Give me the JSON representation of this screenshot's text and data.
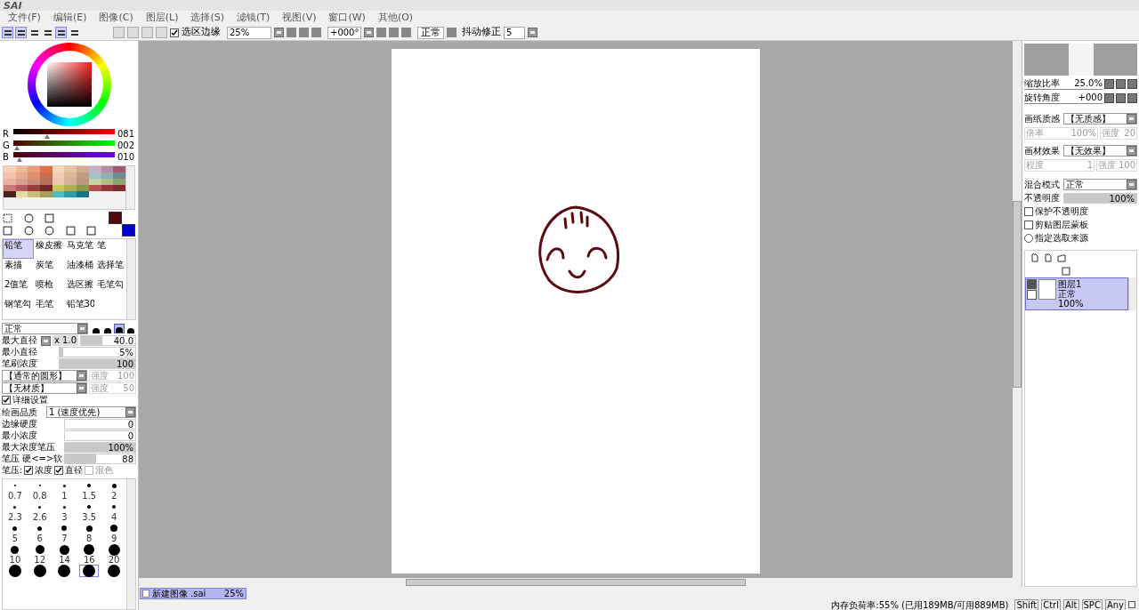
{
  "app": {
    "logo": "SAI"
  },
  "menu": [
    "文件(F)",
    "编辑(E)",
    "图像(C)",
    "图层(L)",
    "选择(S)",
    "滤镜(T)",
    "视图(V)",
    "窗口(W)",
    "其他(O)"
  ],
  "panel_toggles": [
    {
      "selected": true
    },
    {
      "selected": true
    },
    {
      "selected": false
    },
    {
      "selected": false
    },
    {
      "selected": true
    },
    {
      "selected": false
    }
  ],
  "toolbar": {
    "selection_edge": {
      "label": "选区边缘",
      "checked": true
    },
    "zoom": "25%",
    "rotation": "+000°",
    "view_mode": "正常",
    "stabilizer": {
      "label": "抖动修正",
      "value": "5"
    }
  },
  "color_sliders": [
    {
      "kind": "r",
      "label": "R",
      "level": 0.32,
      "reading": "081"
    },
    {
      "kind": "g",
      "label": "G",
      "level": 0.01,
      "reading": "002"
    },
    {
      "kind": "b",
      "label": "B",
      "level": 0.04,
      "reading": "010"
    }
  ],
  "swatches": [
    {
      "color": "#f5d2b9"
    },
    {
      "color": "#f0b996"
    },
    {
      "color": "#eb9b73"
    },
    {
      "color": "#e06e46"
    },
    {
      "color": "#f5d7be"
    },
    {
      "color": "#e6c3a5"
    },
    {
      "color": "#d2aa91"
    },
    {
      "color": "#c3afc8"
    },
    {
      "color": "#b48ca0"
    },
    {
      "color": "#a05a6e"
    },
    {
      "color": "#f0c3aa"
    },
    {
      "color": "#e6aa8c"
    },
    {
      "color": "#dc916e"
    },
    {
      "color": "#c86e50"
    },
    {
      "color": "#f0cdb4"
    },
    {
      "color": "#dcb496"
    },
    {
      "color": "#c39b82"
    },
    {
      "color": "#a5bec8"
    },
    {
      "color": "#8cafb4"
    },
    {
      "color": "#6e8c96"
    },
    {
      "color": "#e6b4a0"
    },
    {
      "color": "#d7a08c"
    },
    {
      "color": "#c88c78"
    },
    {
      "color": "#b46e5a"
    },
    {
      "color": "#ebc8af"
    },
    {
      "color": "#d7af96"
    },
    {
      "color": "#be967d"
    },
    {
      "color": "#c8d2a0"
    },
    {
      "color": "#afbe82"
    },
    {
      "color": "#8ca56e"
    },
    {
      "color": "#c87878"
    },
    {
      "color": "#b45a5a"
    },
    {
      "color": "#963c3c"
    },
    {
      "color": "#6e2828"
    },
    {
      "color": "#c8c85a"
    },
    {
      "color": "#b4aa50"
    },
    {
      "color": "#8c9646"
    },
    {
      "color": "#b45050"
    },
    {
      "color": "#963737"
    },
    {
      "color": "#7d2d2d"
    },
    {
      "color": "#502020"
    },
    {
      "color": "#e6dca0"
    },
    {
      "color": "#c8be78"
    },
    {
      "color": "#a0a05a"
    },
    {
      "color": "#46bec3"
    },
    {
      "color": "#28a0aa"
    },
    {
      "color": "#147882"
    }
  ],
  "current_colors": [
    {
      "color": "#520a0e"
    },
    {
      "color": "#0000cc"
    }
  ],
  "tools": [
    {
      "label": "铅笔",
      "selected": true
    },
    {
      "label": "橡皮擦",
      "selected": false
    },
    {
      "label": "马克笔",
      "selected": false
    },
    {
      "label": "笔",
      "selected": false
    },
    {
      "label": "素描",
      "selected": false
    },
    {
      "label": "炭笔",
      "selected": false
    },
    {
      "label": "油漆桶",
      "selected": false
    },
    {
      "label": "选择笔",
      "selected": false
    },
    {
      "label": "2值笔",
      "selected": false
    },
    {
      "label": "喷枪",
      "selected": false
    },
    {
      "label": "选区擦",
      "selected": false
    },
    {
      "label": "毛笔勾",
      "selected": false
    },
    {
      "label": "钢笔勾",
      "selected": false
    },
    {
      "label": "毛笔",
      "selected": false
    },
    {
      "label": "铅笔30",
      "selected": false
    }
  ],
  "brush": {
    "blend_mode": "正常",
    "shapes": [
      {
        "selected": false
      },
      {
        "selected": false
      },
      {
        "selected": true
      },
      {
        "selected": false
      }
    ],
    "max_diameter": {
      "label": "最大直径",
      "multiplier": "x 1.0",
      "value": "40.0",
      "level": 0.4
    },
    "min_diameter": {
      "label": "最小直径",
      "value": "5%",
      "level": 0.05
    },
    "density": {
      "label": "笔刷浓度",
      "value": "100",
      "level": 1
    },
    "shape": {
      "value": "【通常的圆形】",
      "strength_label": "强度",
      "strength": "100",
      "disabled": true
    },
    "texture": {
      "value": "【无材质】",
      "strength_label": "强度",
      "strength": "50",
      "disabled": true
    },
    "details": {
      "label": "详细设置",
      "checked": true
    },
    "quality": {
      "label": "绘画品质",
      "value": "1 (速度优先)"
    },
    "params": [
      {
        "label": "边缘硬度",
        "value": "0",
        "level": 0
      },
      {
        "label": "最小浓度",
        "value": "0",
        "level": 0
      },
      {
        "label": "最大浓度笔压",
        "value": "100%",
        "level": 1
      },
      {
        "label": "笔压 硬<=>软",
        "value": "88",
        "level": 0.44
      }
    ],
    "pressure": {
      "label": "笔压:",
      "options": [
        {
          "label": "浓度",
          "checked": true,
          "disabled": false
        },
        {
          "label": "直径",
          "checked": true,
          "disabled": false
        },
        {
          "label": "混色",
          "checked": false,
          "disabled": true
        }
      ]
    }
  },
  "brush_sizes": [
    {
      "label": "0.7",
      "selected": false
    },
    {
      "label": "0.8",
      "selected": false
    },
    {
      "label": "1",
      "selected": false
    },
    {
      "label": "1.5",
      "selected": false
    },
    {
      "label": "2",
      "selected": false
    },
    {
      "label": "2.3",
      "selected": false
    },
    {
      "label": "2.6",
      "selected": false
    },
    {
      "label": "3",
      "selected": false
    },
    {
      "label": "3.5",
      "selected": false
    },
    {
      "label": "4",
      "selected": false
    },
    {
      "label": "5",
      "selected": false
    },
    {
      "label": "6",
      "selected": false
    },
    {
      "label": "7",
      "selected": false
    },
    {
      "label": "8",
      "selected": false
    },
    {
      "label": "9",
      "selected": false
    },
    {
      "label": "10",
      "selected": false
    },
    {
      "label": "12",
      "selected": false
    },
    {
      "label": "14",
      "selected": false
    },
    {
      "label": "16",
      "selected": false
    },
    {
      "label": "20",
      "selected": false
    },
    {
      "selected": false
    },
    {
      "selected": false
    },
    {
      "selected": false
    },
    {
      "selected": true
    },
    {
      "selected": false
    }
  ],
  "navigator": {
    "zoom_label": "缩放比率",
    "zoom": "25.0%",
    "rotation_label": "旋转角度",
    "rotation": "+000"
  },
  "paper_texture": {
    "label": "画纸质感",
    "value": "【无质感】",
    "scale_label": "倍率",
    "scale": "100%",
    "strength_label": "强度",
    "strength": "20",
    "disabled": true
  },
  "material_effect": {
    "label": "画材效果",
    "value": "【无效果】",
    "amount_label": "程度",
    "amount": "1",
    "strength_label": "强度",
    "strength": "100",
    "disabled": true
  },
  "layer_props": {
    "blend_label": "混合模式",
    "blend": "正常",
    "opacity_label": "不透明度",
    "opacity": {
      "value": "100%",
      "level": 1
    },
    "options": [
      {
        "kind": "checkbox",
        "label": "保护不透明度",
        "checked": false
      },
      {
        "kind": "checkbox",
        "label": "剪贴图层蒙板",
        "checked": false
      },
      {
        "kind": "radio",
        "label": "指定选取来源",
        "checked": false
      }
    ]
  },
  "layers": [
    {
      "name": "图层1",
      "mode": "正常",
      "opacity": "100%",
      "selected": true,
      "visible": true
    }
  ],
  "documents": [
    {
      "name": "新建图像",
      "ext": ".sai",
      "zoom": "25%",
      "selected": true
    }
  ],
  "status": {
    "memory": "内存负荷率:55% (已用189MB/可用889MB)",
    "keys": [
      "Shift",
      "Ctrl",
      "Alt",
      "SPC",
      "Any"
    ]
  }
}
